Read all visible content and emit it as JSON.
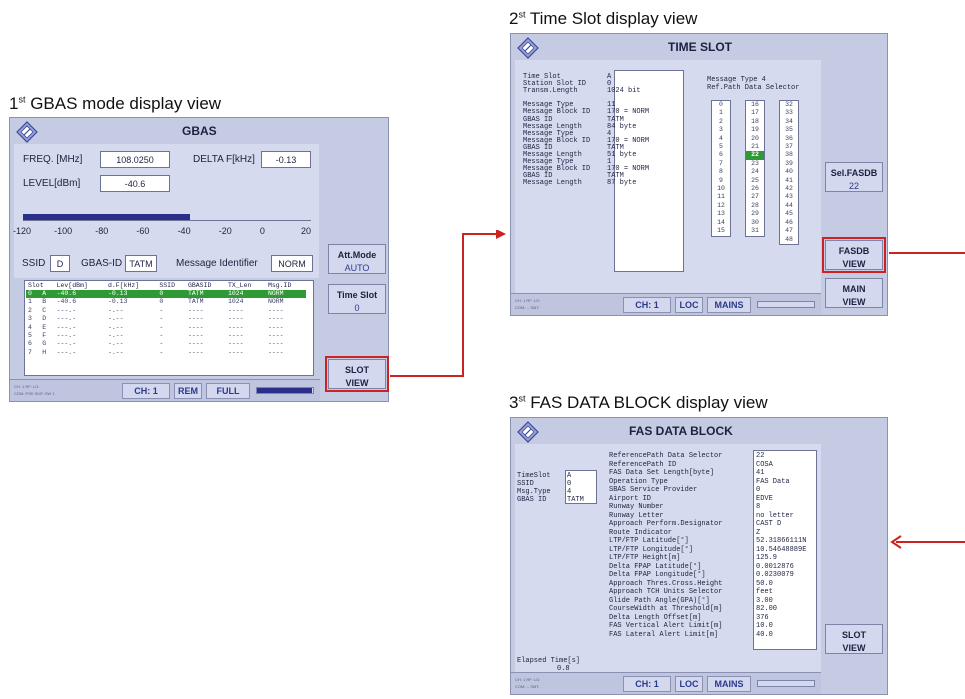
{
  "captions": {
    "view1": "1st GBAS mode display view",
    "view2": "2st Time Slot display view",
    "view3": "3st FAS DATA BLOCK display view",
    "view1_num": "1",
    "view1_sup": "st",
    "view1_rest": " GBAS mode display view",
    "view2_num": "2",
    "view2_sup": "st",
    "view2_rest": " Time Slot display view",
    "view3_num": "3",
    "view3_sup": "st",
    "view3_rest": " FAS DATA BLOCK display view"
  },
  "gbas": {
    "title": "GBAS",
    "freq_label": "FREQ. [MHz]",
    "freq_value": "108.0250",
    "delta_label": "DELTA F[kHz]",
    "delta_value": "-0.13",
    "level_label": "LEVEL[dBm]",
    "level_value": "-40.6",
    "level_fraction": 0.58,
    "scale": [
      "-120",
      "-100",
      "-80",
      "-60",
      "-40",
      "-20",
      "0",
      "20"
    ],
    "ssid_label": "SSID",
    "ssid_value": "D",
    "gbasid_label": "GBAS-ID",
    "gbasid_value": "TATM",
    "msgid_label": "Message Identifier",
    "msgid_value": "NORM",
    "table_headers": [
      "Slot",
      "Lev[dBm]",
      "d.F[kHz]",
      "SSID",
      "GBASID",
      "TX_Len",
      "Msg.ID"
    ],
    "table_rows": [
      [
        "0",
        "A",
        "-40.6",
        "-0.13",
        "0",
        "TATM",
        "1024",
        "NORM"
      ],
      [
        "1",
        "B",
        "-40.6",
        "-0.13",
        "0",
        "TATM",
        "1024",
        "NORM"
      ],
      [
        "2",
        "C",
        "---.-",
        "-.--",
        "-",
        "----",
        "----",
        "----"
      ],
      [
        "3",
        "D",
        "---.-",
        "-.--",
        "-",
        "----",
        "----",
        "----"
      ],
      [
        "4",
        "E",
        "---.-",
        "-.--",
        "-",
        "----",
        "----",
        "----"
      ],
      [
        "5",
        "F",
        "---.-",
        "-.--",
        "-",
        "----",
        "----",
        "----"
      ],
      [
        "6",
        "G",
        "---.-",
        "-.--",
        "-",
        "----",
        "----",
        "----"
      ],
      [
        "7",
        "H",
        "---.-",
        "-.--",
        "-",
        "----",
        "----",
        "----"
      ]
    ],
    "buttons": {
      "att_mode": "Att.Mode",
      "att_mode_value": "AUTO",
      "time_slot": "Time Slot",
      "time_slot_value": "0",
      "slot_view_1": "SLOT",
      "slot_view_2": "VIEW"
    },
    "status": {
      "ch": "CH: 1",
      "mode": "REM",
      "power": "FULL",
      "tiny1": "CH: 1  RF:   LO:",
      "tiny2": "COM: PSK  SMT: SW 1",
      "bar_fraction": 0.98
    }
  },
  "timeslot": {
    "title": "TIME SLOT",
    "info_lines": [
      "Time Slot           A",
      "Station Slot ID     0",
      "Transm.Length       1024 bit",
      "",
      "Message Type        11",
      "Message Block ID    170 = NORM",
      "GBAS ID             TATM",
      "Message Length      84 byte",
      "Message Type        4",
      "Message Block ID    170 = NORM",
      "GBAS ID             TATM",
      "Message Length      51 byte",
      "Message Type        1",
      "Message Block ID    170 = NORM",
      "GBAS ID             TATM",
      "Message Length      87 byte"
    ],
    "ref_header_1": "Message Type 4",
    "ref_header_2": "Ref.Path Data Selector",
    "col1": [
      "0",
      "1",
      "2",
      "3",
      "4",
      "5",
      "6",
      "7",
      "8",
      "9",
      "10",
      "11",
      "12",
      "13",
      "14",
      "15"
    ],
    "col2": [
      "16",
      "17",
      "18",
      "19",
      "20",
      "21",
      "22",
      "23",
      "24",
      "25",
      "26",
      "27",
      "28",
      "29",
      "30",
      "31"
    ],
    "col3": [
      "32",
      "33",
      "34",
      "35",
      "36",
      "37",
      "38",
      "39",
      "40",
      "41",
      "42",
      "43",
      "44",
      "45",
      "46",
      "47",
      "48"
    ],
    "highlighted": "22",
    "buttons": {
      "sel_fasdb": "Sel.FASDB",
      "sel_fasdb_value": "22",
      "fasdb_view_1": "FASDB",
      "fasdb_view_2": "VIEW",
      "main_view_1": "MAIN",
      "main_view_2": "VIEW"
    },
    "status": {
      "ch": "CH: 1",
      "mode": "LOC",
      "power": "MAINS",
      "tiny1": "CH: 1  RF:   LO:",
      "tiny2": "COM: --  SMT:"
    }
  },
  "fas": {
    "title": "FAS DATA BLOCK",
    "left_lines": [
      "TimeSlot A",
      "SSID     0",
      "Msg.Type 4",
      "GBAS ID  TATM"
    ],
    "left_keys": [
      "TimeSlot",
      "SSID",
      "Msg.Type",
      "GBAS ID"
    ],
    "left_vals": [
      "A",
      "0",
      "4",
      "TATM"
    ],
    "elapsed_label": "Elapsed Time[s]",
    "elapsed_value": "0.8",
    "params": [
      [
        "ReferencePath Data Selector",
        "22"
      ],
      [
        "ReferencePath ID",
        "COSA"
      ],
      [
        "FAS Data Set Length[byte]",
        "41"
      ],
      [
        "Operation Type",
        "FAS Data"
      ],
      [
        "SBAS Service Provider",
        "0"
      ],
      [
        "Airport ID",
        "EDVE"
      ],
      [
        "Runway Number",
        "8"
      ],
      [
        "Runway Letter",
        "no letter"
      ],
      [
        "Approach Perform.Designator",
        "CAST D"
      ],
      [
        "Route Indicator",
        "Z"
      ],
      [
        "LTP/FTP Latitude[°]",
        "52.31866111N"
      ],
      [
        "LTP/FTP Longitude[°]",
        "10.54648889E"
      ],
      [
        "LTP/FTP Height[m]",
        "125.9"
      ],
      [
        "Delta FPAP Latitude[°]",
        "0.0012876"
      ],
      [
        "Delta FPAP Longitude[°]",
        "0.0230079"
      ],
      [
        "Approach Thres.Cross.Height",
        "50.0"
      ],
      [
        "Approach TCH Units Selector",
        "feet"
      ],
      [
        "Glide Path Angle(GPA)[°]",
        "3.00"
      ],
      [
        "CourseWidth at Threshold[m]",
        "82.00"
      ],
      [
        "Delta Length Offset[m]",
        "376"
      ],
      [
        "FAS Vertical Alert Limit[m]",
        "10.0"
      ],
      [
        "FAS Lateral Alert Limit[m]",
        "40.0"
      ]
    ],
    "buttons": {
      "slot_view_1": "SLOT",
      "slot_view_2": "VIEW"
    },
    "status": {
      "ch": "CH: 1",
      "mode": "LOC",
      "power": "MAINS",
      "tiny1": "CH: 1  RF:   LO:",
      "tiny2": "COM: --  SMT:"
    }
  },
  "colors": {
    "arrow": "#cc2222",
    "panel_bg": "#c5cbe3",
    "highlight": "#2f9a35",
    "bar": "#2b2f8a"
  }
}
